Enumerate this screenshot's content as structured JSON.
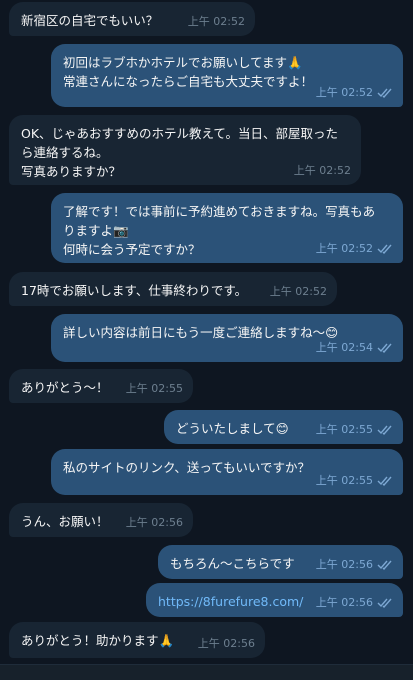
{
  "messages": [
    {
      "dir": "in",
      "text": "新宿区の自宅でもいい？",
      "time": "上午 02:52"
    },
    {
      "dir": "out",
      "text": "初回はラブホかホテルでお願いしてます🙏\n常連さんになったらご自宅も大丈夫ですよ！",
      "time": "上午 02:52"
    },
    {
      "dir": "in",
      "text": "OK、じゃあおすすめのホテル教えて。当日、部屋取った\nら連絡するね。\n写真ありますか？",
      "time": "上午 02:52"
    },
    {
      "dir": "out",
      "text": "了解です！では事前に予約進めておきますね。写真もあ\nりますよ📷\n何時に会う予定ですか？",
      "time": "上午 02:52"
    },
    {
      "dir": "in",
      "text": "17時でお願いします、仕事終わりです。",
      "time": "上午 02:52"
    },
    {
      "dir": "out",
      "text": "詳しい内容は前日にもう一度ご連絡しますね～😊",
      "time": "上午 02:54"
    },
    {
      "dir": "in",
      "text": "ありがとう～！",
      "time": "上午 02:55"
    },
    {
      "dir": "out",
      "text": "どういたしまして😊",
      "time": "上午 02:55"
    },
    {
      "dir": "out",
      "text": "私のサイトのリンク、送ってもいいですか？",
      "time": "上午 02:55"
    },
    {
      "dir": "in",
      "text": "うん、お願い！",
      "time": "上午 02:56"
    },
    {
      "dir": "out",
      "text": "もちろん～こちらです",
      "time": "上午 02:56"
    },
    {
      "dir": "out",
      "text": "https://8furefure8.com/",
      "time": "上午 02:56",
      "link": true
    },
    {
      "dir": "in",
      "text": "ありがとう！助かります🙏",
      "time": "上午 02:56"
    }
  ],
  "colors": {
    "background": "#0e1621",
    "incoming_bubble": "#182533",
    "outgoing_bubble": "#2b5278",
    "link": "#71baf9",
    "read_ticks": "#7da8d3"
  },
  "icons": {
    "read_status": "double-check-icon"
  }
}
